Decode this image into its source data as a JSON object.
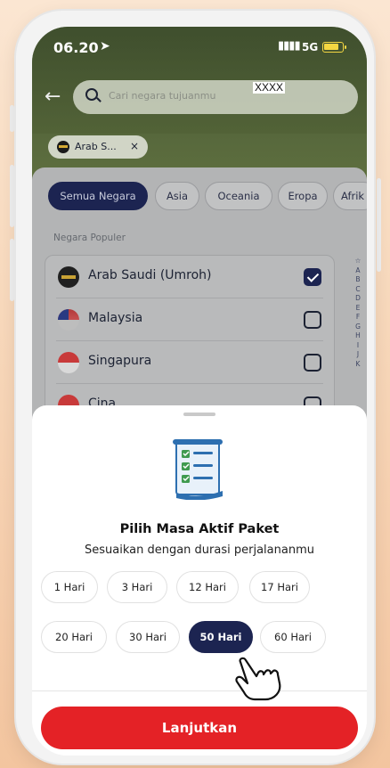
{
  "status_bar": {
    "time": "06.20",
    "network": "5G"
  },
  "search": {
    "placeholder": "Cari negara tujuanmu",
    "overlay_tag": "XXXX"
  },
  "selected_chip": {
    "label": "Arab S...",
    "remove": "×"
  },
  "tabs": [
    {
      "label": "Semua Negara",
      "active": true
    },
    {
      "label": "Asia",
      "active": false
    },
    {
      "label": "Oceania",
      "active": false
    },
    {
      "label": "Eropa",
      "active": false
    },
    {
      "label": "Afrik",
      "active": false
    }
  ],
  "country_section": {
    "label": "Negara Populer",
    "countries": [
      {
        "name": "Arab Saudi (Umroh)",
        "checked": true
      },
      {
        "name": "Malaysia",
        "checked": false
      },
      {
        "name": "Singapura",
        "checked": false
      },
      {
        "name": "Cina",
        "checked": false
      }
    ],
    "alphabet_index": [
      "☆",
      "A",
      "B",
      "C",
      "D",
      "E",
      "F",
      "G",
      "H",
      "I",
      "J",
      "K"
    ]
  },
  "sheet": {
    "title": "Pilih Masa Aktif Paket",
    "subtitle": "Sesuaikan dengan durasi perjalananmu",
    "durations": [
      {
        "label": "1 Hari",
        "active": false
      },
      {
        "label": "3 Hari",
        "active": false
      },
      {
        "label": "12 Hari",
        "active": false
      },
      {
        "label": "17 Hari",
        "active": false
      },
      {
        "label": "20 Hari",
        "active": false
      },
      {
        "label": "30 Hari",
        "active": false
      },
      {
        "label": "50 Hari",
        "active": true
      },
      {
        "label": "60 Hari",
        "active": false
      }
    ],
    "cta_label": "Lanjutkan"
  },
  "colors": {
    "primary_navy": "#1c2451",
    "cta_red": "#e42226",
    "battery_yellow": "#f4d742"
  },
  "icons": {
    "location": "location-arrow-icon",
    "signal": "signal-bars-icon",
    "battery": "battery-charging-icon",
    "back": "back-arrow-icon",
    "search": "search-icon",
    "sheet_illustration": "checklist-scroll-icon",
    "pointer": "tap-hand-icon"
  }
}
